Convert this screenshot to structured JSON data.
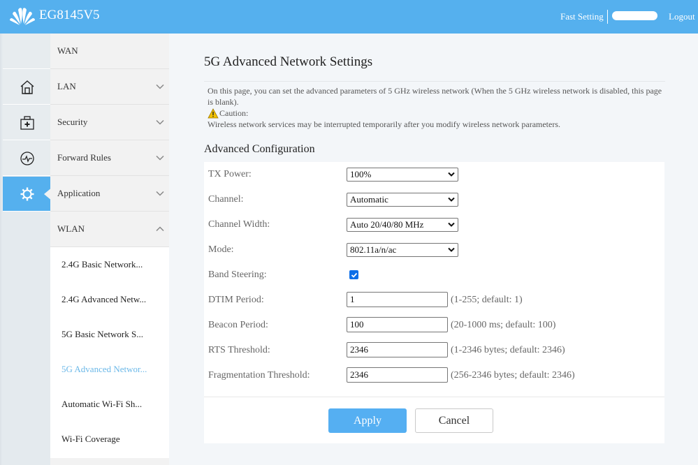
{
  "header": {
    "model": "EG8145V5",
    "fast_setting": "Fast Setting",
    "logout": "Logout",
    "brand_color": "#55b0ee"
  },
  "sidebar": {
    "icons": [
      {
        "name": "home-icon"
      },
      {
        "name": "security-kit-icon"
      },
      {
        "name": "pulse-icon"
      },
      {
        "name": "gear-icon",
        "active": true
      }
    ],
    "menu": [
      {
        "label": "WAN",
        "chevron": "none"
      },
      {
        "label": "LAN",
        "chevron": "down"
      },
      {
        "label": "Security",
        "chevron": "down"
      },
      {
        "label": "Forward Rules",
        "chevron": "down"
      },
      {
        "label": "Application",
        "chevron": "down"
      },
      {
        "label": "WLAN",
        "chevron": "up",
        "expanded": true
      }
    ],
    "submenu": [
      {
        "label": "2.4G Basic Network..."
      },
      {
        "label": "2.4G Advanced Netw..."
      },
      {
        "label": "5G Basic Network S..."
      },
      {
        "label": "5G Advanced Networ...",
        "active": true
      },
      {
        "label": "Automatic Wi-Fi Sh..."
      },
      {
        "label": "Wi-Fi Coverage"
      }
    ],
    "active_color": "#6bb8e8"
  },
  "main": {
    "title": "5G Advanced Network Settings",
    "description": "On this page, you can set the advanced parameters of 5 GHz wireless network (When the 5 GHz wireless network is disabled, this page is blank).",
    "caution_label": "Caution:",
    "caution_text": "Wireless network services may be interrupted temporarily after you modify wireless network parameters.",
    "section_title": "Advanced Configuration",
    "fields": {
      "tx_power": {
        "label": "TX Power:",
        "value": "100%"
      },
      "channel": {
        "label": "Channel:",
        "value": "Automatic"
      },
      "channel_width": {
        "label": "Channel Width:",
        "value": "Auto 20/40/80 MHz"
      },
      "mode": {
        "label": "Mode:",
        "value": "802.11a/n/ac"
      },
      "band_steering": {
        "label": "Band Steering:",
        "checked": true
      },
      "dtim_period": {
        "label": "DTIM Period:",
        "value": "1",
        "hint": "(1-255; default: 1)"
      },
      "beacon_period": {
        "label": "Beacon Period:",
        "value": "100",
        "hint": "(20-1000 ms; default: 100)"
      },
      "rts_threshold": {
        "label": "RTS Threshold:",
        "value": "2346",
        "hint": "(1-2346 bytes; default: 2346)"
      },
      "frag_threshold": {
        "label": "Fragmentation Threshold:",
        "value": "2346",
        "hint": "(256-2346 bytes; default: 2346)"
      }
    },
    "buttons": {
      "apply": "Apply",
      "cancel": "Cancel"
    },
    "apply_color": "#55aff2"
  }
}
